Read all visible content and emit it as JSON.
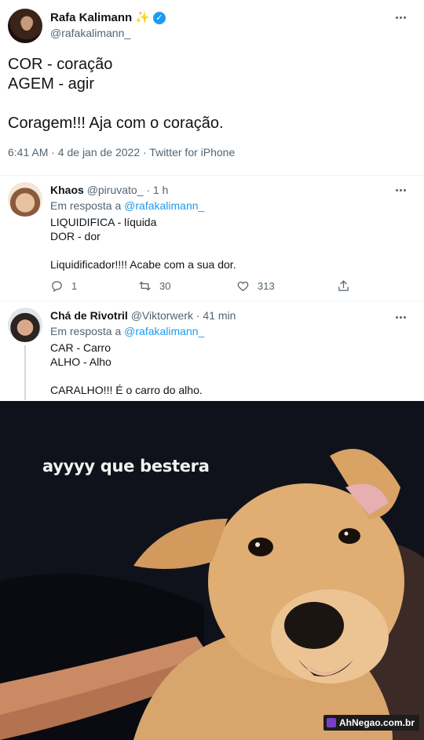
{
  "main_tweet": {
    "author_name": "Rafa Kalimann",
    "author_emoji": "✨",
    "author_handle": "@rafakalimann_",
    "text": "COR - coração\nAGEM - agir\n\nCoragem!!! Aja com o coração.",
    "meta": "6:41 AM · 4 de jan de 2022 · Twitter for iPhone"
  },
  "replies": [
    {
      "name": "Khaos",
      "handle_time": "@piruvato_ · 1 h",
      "reply_prefix": "Em resposta a ",
      "reply_to": "@rafakalimann_",
      "text": "LIQUIDIFICA - líquida\nDOR - dor\n\nLiquidificador!!!! Acabe com a sua dor.",
      "replies_count": "1",
      "retweets_count": "30",
      "likes_count": "313"
    },
    {
      "name": "Chá de Rivotril",
      "handle_time": "@Viktorwerk · 41 min",
      "reply_prefix": "Em resposta a ",
      "reply_to": "@rafakalimann_",
      "text": "CAR - Carro\nALHO - Alho\n\nCARALHO!!! É o carro do alho."
    }
  ],
  "meme": {
    "caption": "ayyyy que bestera",
    "watermark": "AhNegao.com.br"
  },
  "colors": {
    "link": "#1d9bf0",
    "secondary_text": "#536471",
    "verified": "#1d9bf0"
  }
}
